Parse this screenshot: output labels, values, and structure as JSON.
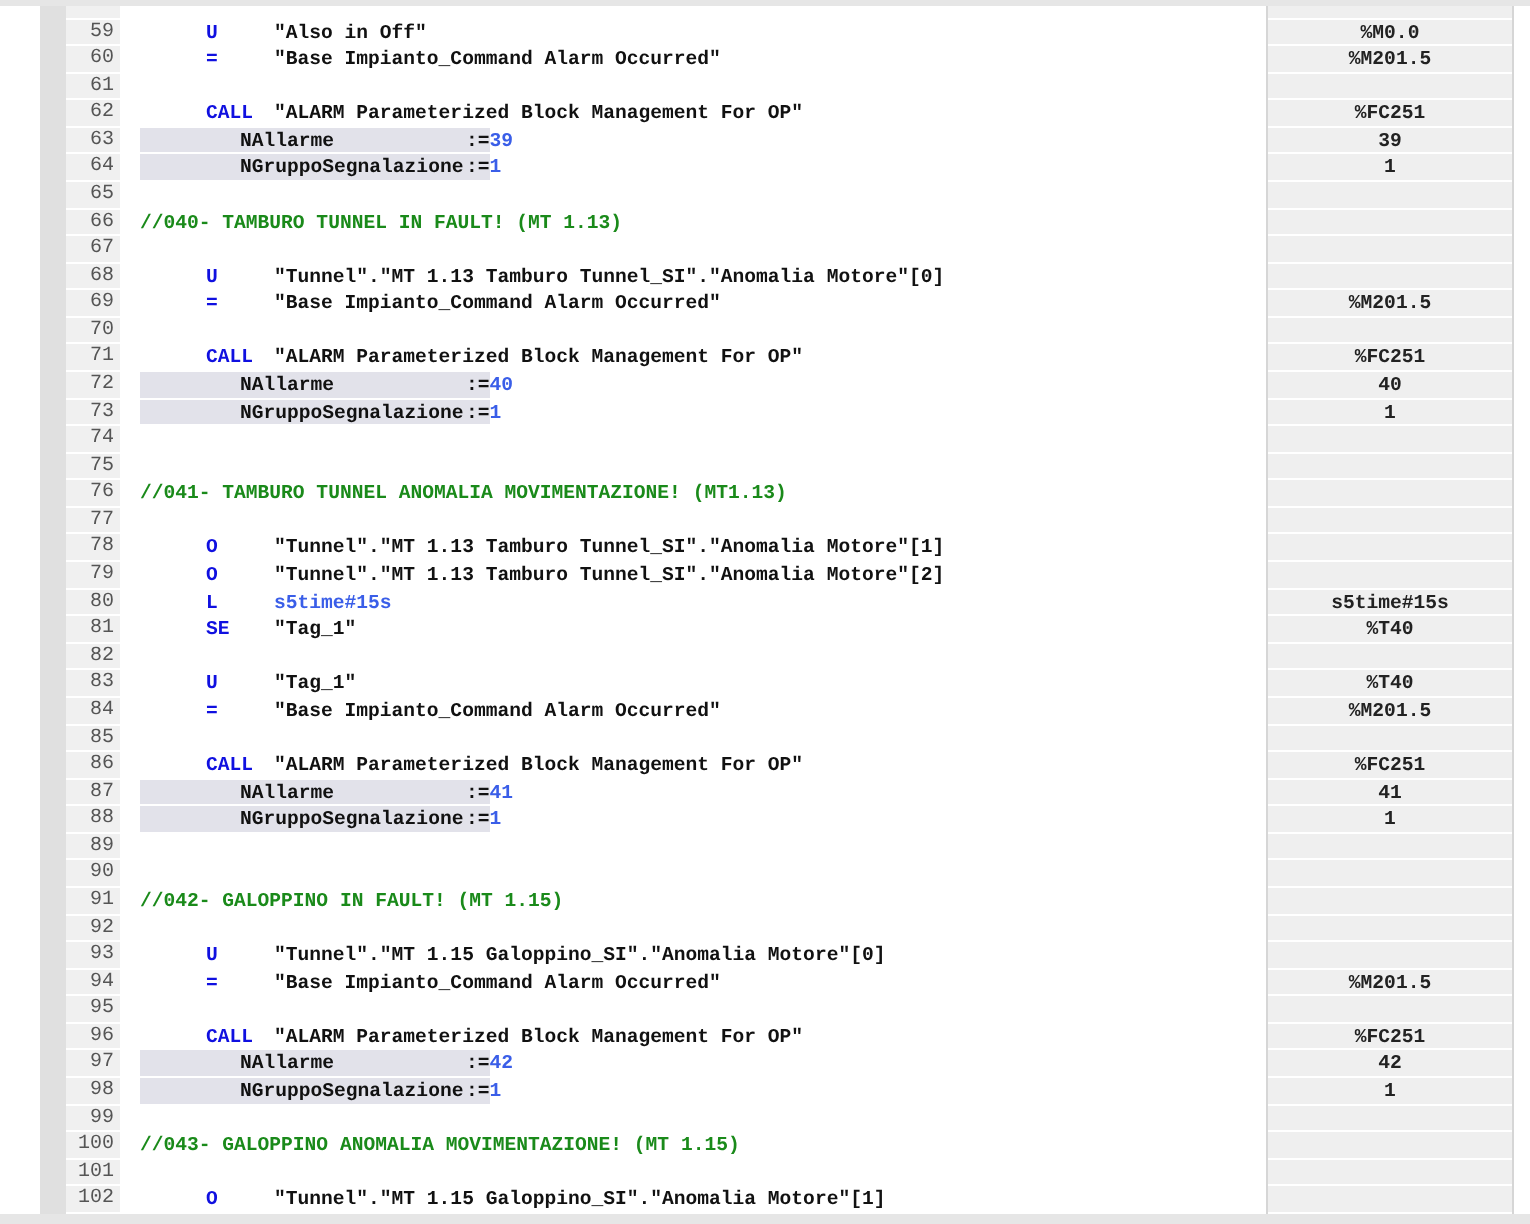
{
  "lines": [
    {
      "number": "59",
      "kind": "instr",
      "op": "U",
      "operand": "\"Also in Off\"",
      "address": "%M0.0"
    },
    {
      "number": "60",
      "kind": "instr",
      "op": "=",
      "operand": "\"Base Impianto_Command Alarm Occurred\"",
      "address": "%M201.5"
    },
    {
      "number": "61",
      "kind": "blank"
    },
    {
      "number": "62",
      "kind": "instr",
      "op": "CALL",
      "operand": "\"ALARM Parameterized Block Management For OP\"",
      "address": "%FC251"
    },
    {
      "number": "63",
      "kind": "param",
      "name": "NAllarme",
      "assign": ":=",
      "value": "39",
      "address": "39"
    },
    {
      "number": "64",
      "kind": "param",
      "name": "NGruppoSegnalazione",
      "assign": ":=",
      "value": "1",
      "address": "1"
    },
    {
      "number": "65",
      "kind": "blank"
    },
    {
      "number": "66",
      "kind": "comment",
      "text": "//040- TAMBURO TUNNEL IN FAULT! (MT 1.13)"
    },
    {
      "number": "67",
      "kind": "blank"
    },
    {
      "number": "68",
      "kind": "instr",
      "op": "U",
      "operand": "\"Tunnel\".\"MT 1.13 Tamburo Tunnel_SI\".\"Anomalia Motore\"[0]"
    },
    {
      "number": "69",
      "kind": "instr",
      "op": "=",
      "operand": "\"Base Impianto_Command Alarm Occurred\"",
      "address": "%M201.5"
    },
    {
      "number": "70",
      "kind": "blank"
    },
    {
      "number": "71",
      "kind": "instr",
      "op": "CALL",
      "operand": "\"ALARM Parameterized Block Management For OP\"",
      "address": "%FC251"
    },
    {
      "number": "72",
      "kind": "param",
      "name": "NAllarme",
      "assign": ":=",
      "value": "40",
      "address": "40"
    },
    {
      "number": "73",
      "kind": "param",
      "name": "NGruppoSegnalazione",
      "assign": ":=",
      "value": "1",
      "address": "1"
    },
    {
      "number": "74",
      "kind": "blank"
    },
    {
      "number": "75",
      "kind": "blank"
    },
    {
      "number": "76",
      "kind": "comment",
      "text": "//041- TAMBURO TUNNEL ANOMALIA MOVIMENTAZIONE! (MT1.13)"
    },
    {
      "number": "77",
      "kind": "blank"
    },
    {
      "number": "78",
      "kind": "instr",
      "op": "O",
      "operand": "\"Tunnel\".\"MT 1.13 Tamburo Tunnel_SI\".\"Anomalia Motore\"[1]"
    },
    {
      "number": "79",
      "kind": "instr",
      "op": "O",
      "operand": "\"Tunnel\".\"MT 1.13 Tamburo Tunnel_SI\".\"Anomalia Motore\"[2]"
    },
    {
      "number": "80",
      "kind": "load",
      "op": "L",
      "operand": "s5time#15s",
      "address": "s5time#15s"
    },
    {
      "number": "81",
      "kind": "instr",
      "op": "SE",
      "operand": "\"Tag_1\"",
      "address": "%T40"
    },
    {
      "number": "82",
      "kind": "blank"
    },
    {
      "number": "83",
      "kind": "instr",
      "op": "U",
      "operand": "\"Tag_1\"",
      "address": "%T40"
    },
    {
      "number": "84",
      "kind": "instr",
      "op": "=",
      "operand": "\"Base Impianto_Command Alarm Occurred\"",
      "address": "%M201.5"
    },
    {
      "number": "85",
      "kind": "blank"
    },
    {
      "number": "86",
      "kind": "instr",
      "op": "CALL",
      "operand": "\"ALARM Parameterized Block Management For OP\"",
      "address": "%FC251"
    },
    {
      "number": "87",
      "kind": "param",
      "name": "NAllarme",
      "assign": ":=",
      "value": "41",
      "address": "41"
    },
    {
      "number": "88",
      "kind": "param",
      "name": "NGruppoSegnalazione",
      "assign": ":=",
      "value": "1",
      "address": "1"
    },
    {
      "number": "89",
      "kind": "blank"
    },
    {
      "number": "90",
      "kind": "blank"
    },
    {
      "number": "91",
      "kind": "comment",
      "text": "//042- GALOPPINO IN FAULT! (MT 1.15)"
    },
    {
      "number": "92",
      "kind": "blank"
    },
    {
      "number": "93",
      "kind": "instr",
      "op": "U",
      "operand": "\"Tunnel\".\"MT 1.15 Galoppino_SI\".\"Anomalia Motore\"[0]"
    },
    {
      "number": "94",
      "kind": "instr",
      "op": "=",
      "operand": "\"Base Impianto_Command Alarm Occurred\"",
      "address": "%M201.5"
    },
    {
      "number": "95",
      "kind": "blank"
    },
    {
      "number": "96",
      "kind": "instr",
      "op": "CALL",
      "operand": "\"ALARM Parameterized Block Management For OP\"",
      "address": "%FC251"
    },
    {
      "number": "97",
      "kind": "param",
      "name": "NAllarme",
      "assign": ":=",
      "value": "42",
      "address": "42"
    },
    {
      "number": "98",
      "kind": "param",
      "name": "NGruppoSegnalazione",
      "assign": ":=",
      "value": "1",
      "address": "1"
    },
    {
      "number": "99",
      "kind": "blank"
    },
    {
      "number": "100",
      "kind": "comment",
      "text": "//043- GALOPPINO ANOMALIA MOVIMENTAZIONE! (MT 1.15)"
    },
    {
      "number": "101",
      "kind": "blank"
    },
    {
      "number": "102",
      "kind": "instr",
      "op": "O",
      "operand": "\"Tunnel\".\"MT 1.15 Galoppino_SI\".\"Anomalia Motore\"[1]"
    }
  ]
}
